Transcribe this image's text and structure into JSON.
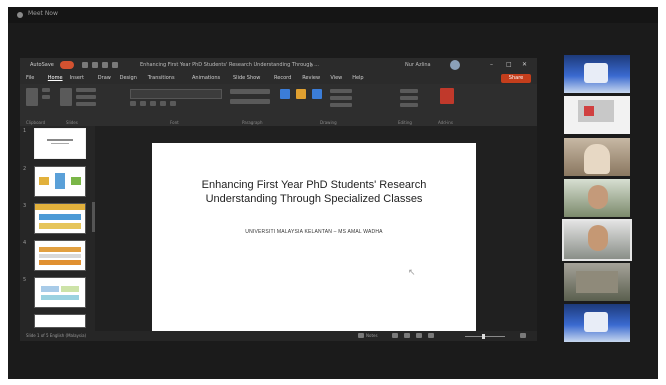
{
  "meeting": {
    "window_title": "Meet Now"
  },
  "powerpoint": {
    "autosave_label": "AutoSave",
    "document_title": "Enhancing First Year PhD Students' Research Understanding Through ...",
    "search_glyph": "⌕",
    "user_label": "Nur Azlina",
    "tabs": [
      "File",
      "Home",
      "Insert",
      "Draw",
      "Design",
      "Transitions",
      "Animations",
      "Slide Show",
      "Record",
      "Review",
      "View",
      "Help"
    ],
    "share_label": "Share",
    "ribbon_groups": [
      "Clipboard",
      "Slides",
      "Font",
      "Paragraph",
      "Drawing",
      "Editing",
      "Add-ins"
    ],
    "slide_count": 5,
    "selected_slide": 1
  },
  "slide": {
    "title": "Enhancing First Year PhD Students' Research Understanding Through Specialized Classes",
    "subtitle": "UNIVERSITI MALAYSIA KELANTAN – MS AMAL WADHA"
  },
  "status_bar": {
    "slide_info": "Slide 1 of 5   English (Malaysia)",
    "notes_label": "Notes"
  },
  "participants": [
    {
      "name": "",
      "icon": "participant-video"
    },
    {
      "name": "",
      "icon": "participant-video"
    },
    {
      "name": "",
      "icon": "participant-video"
    },
    {
      "name": "",
      "icon": "participant-video"
    },
    {
      "name": "",
      "icon": "participant-video"
    },
    {
      "name": "",
      "icon": "participant-video"
    },
    {
      "name": "",
      "icon": "participant-video"
    }
  ],
  "colors": {
    "accent": "#d35230",
    "share": "#c43e1c",
    "app_bg": "#202020"
  }
}
